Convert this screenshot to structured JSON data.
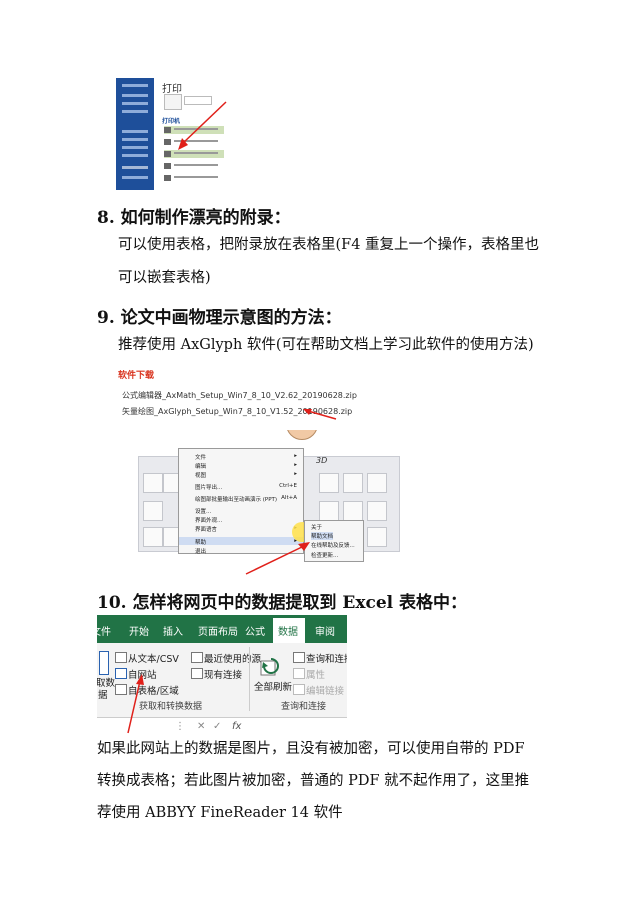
{
  "print_screenshot": {
    "title": "打印",
    "printer_label": "打印机"
  },
  "section8": {
    "heading": "8. 如何制作漂亮的附录：",
    "line1": "可以使用表格，把附录放在表格里(F4 重复上一个操作，表格里也",
    "line2": "可以嵌套表格)"
  },
  "section9": {
    "heading": "9. 论文中画物理示意图的方法：",
    "line1": "推荐使用 AxGlyph 软件(可在帮助文档上学习此软件的使用方法)"
  },
  "download_screenshot": {
    "title": "软件下载",
    "files": [
      "公式编辑器_AxMath_Setup_Win7_8_10_V2.62_20190628.zip",
      "矢量绘图_AxGlyph_Setup_Win7_8_10_V1.52_20190628.zip"
    ]
  },
  "menu_screenshot": {
    "tab_3d": "3D",
    "items": [
      {
        "label": "文件",
        "key": "▸"
      },
      {
        "label": "编辑",
        "key": "▸"
      },
      {
        "label": "视图",
        "key": "▸"
      },
      {
        "label": "图片导出...",
        "key": "Ctrl+E"
      },
      {
        "label": "绘图部批量输出至动画演示 (PPT)",
        "key": "Alt+A"
      },
      {
        "label": "设置...",
        "key": ""
      },
      {
        "label": "界面外观...",
        "key": ""
      },
      {
        "label": "界面语言",
        "key": "▸"
      },
      {
        "label": "帮助",
        "key": "▸"
      },
      {
        "label": "退出",
        "key": ""
      }
    ],
    "submenu": [
      "关于",
      "帮助文档",
      "在线帮助及反馈...",
      "检查更新..."
    ]
  },
  "section10": {
    "heading": "10. 怎样将网页中的数据提取到 Excel 表格中：",
    "line1": "如果此网站上的数据是图片，且没有被加密，可以使用自带的  PDF",
    "line2": "转换成表格；若此图片被加密，普通的 PDF 就不起作用了，这里推",
    "line3": "荐使用 ABBYY FineReader 14 软件"
  },
  "excel_screenshot": {
    "tabs": [
      "文件",
      "开始",
      "插入",
      "页面布局",
      "公式",
      "数据",
      "审阅"
    ],
    "active_tab": "数据",
    "buttons": {
      "from_text": "从文本/CSV",
      "recent_sources": "最近使用的源",
      "from_web": "自网站",
      "existing_connections": "现有连接",
      "from_table": "自表格/区域",
      "get_data_a": "取数",
      "get_data_b": "据",
      "refresh_all": "全部刷新",
      "queries_connections": "查询和连接",
      "properties": "属性",
      "edit_links": "编辑链接"
    },
    "groups": {
      "get_transform": "获取和转换数据",
      "queries": "查询和连接"
    },
    "formula_bar": {
      "fx": "fx"
    }
  },
  "colors": {
    "excel_green": "#217346",
    "arrow_red": "#e0201a",
    "word_blue": "#1e4f9a"
  }
}
